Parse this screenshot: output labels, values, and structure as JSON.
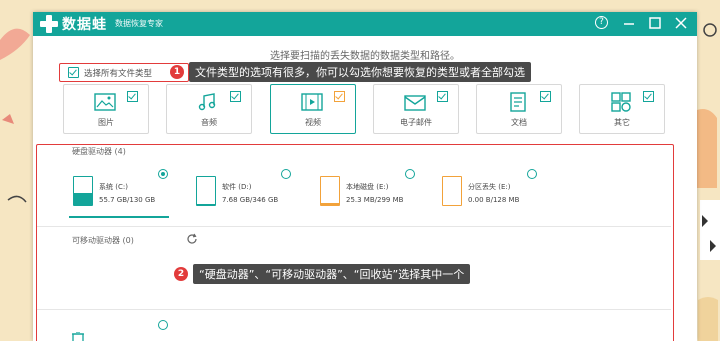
{
  "app": {
    "name": "数据蛙",
    "subtitle": "数据恢复专家",
    "icons": [
      "help-icon",
      "minimize-icon",
      "maximize-icon",
      "close-icon"
    ]
  },
  "instruction": "选择要扫描的丢失数据的数据类型和路径。",
  "select_all_label": "选择所有文件类型",
  "annotations": [
    {
      "number": "1",
      "text": "文件类型的选项有很多，你可以勾选你想要恢复的类型或者全部勾选"
    },
    {
      "number": "2",
      "text": "“硬盘动器”、“可移动驱动器”、“回收站”选择其中一个"
    }
  ],
  "categories": [
    {
      "label": "图片",
      "icon": "image-icon",
      "checked": true
    },
    {
      "label": "音频",
      "icon": "music-icon",
      "checked": true
    },
    {
      "label": "视频",
      "icon": "video-icon",
      "checked": true
    },
    {
      "label": "电子邮件",
      "icon": "email-icon",
      "checked": true
    },
    {
      "label": "文档",
      "icon": "document-icon",
      "checked": true
    },
    {
      "label": "其它",
      "icon": "other-icon",
      "checked": true
    }
  ],
  "hard_drives": {
    "label": "硬盘驱动器 (4)",
    "drives": [
      {
        "name": "系统 (C:)",
        "size": "55.7 GB/130 GB",
        "usage": 0.43,
        "selected": true
      },
      {
        "name": "软件 (D:)",
        "size": "7.68 GB/346 GB",
        "usage": 0.02,
        "selected": false
      },
      {
        "name": "本地磁盘 (E:)",
        "size": "25.3 MB/299 MB",
        "usage": 0.08,
        "selected": false
      },
      {
        "name": "分区丢失 (E:)",
        "size": "0.00  B/128 MB",
        "usage": 0.0,
        "selected": false
      }
    ]
  },
  "removable": {
    "label": "可移动驱动器 (0)",
    "icon": "refresh-icon"
  },
  "colors": {
    "brand": "#13a59a",
    "highlight": "#e23b3b",
    "accent": "#f2a23a"
  }
}
